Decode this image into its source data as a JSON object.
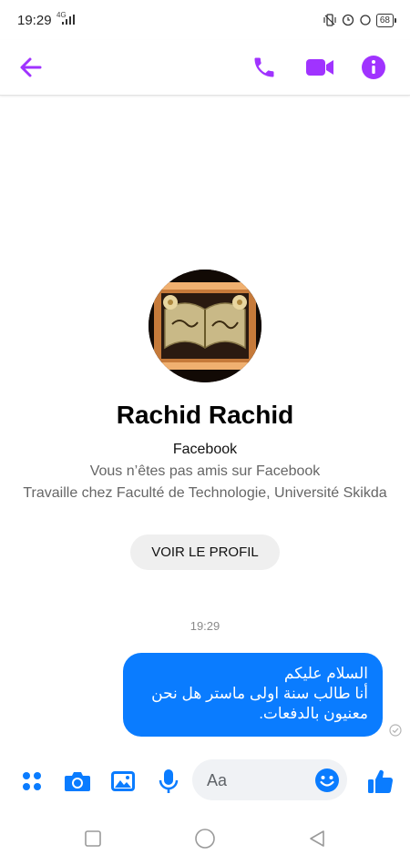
{
  "status_bar": {
    "time": "19:29",
    "network": "4G",
    "battery": "68"
  },
  "header": {
    "back_icon": "arrow-left-icon",
    "call_icon": "phone-icon",
    "video_icon": "video-camera-icon",
    "info_icon": "info-icon",
    "accent_color": "#a033ff"
  },
  "profile": {
    "name": "Rachid Rachid",
    "platform": "Facebook",
    "friend_status": "Vous n’êtes pas amis sur Facebook",
    "work": "Travaille chez Faculté de Technologie, Université Skikda",
    "view_profile_label": "VOIR LE PROFIL"
  },
  "conversation": {
    "timestamp": "19:29",
    "messages": [
      {
        "direction": "outgoing",
        "lines": [
          "السلام عليكم",
          "أنا طالب سنة اولى ماستر هل نحن معنيون بالدفعات."
        ],
        "status": "sent"
      }
    ],
    "bubble_color": "#0a7cff"
  },
  "composer": {
    "placeholder": "Aa",
    "icons": [
      "menu-dots-icon",
      "camera-icon",
      "gallery-icon",
      "microphone-icon",
      "emoji-icon",
      "like-icon"
    ]
  },
  "navbar": {
    "icons": [
      "recent-apps-icon",
      "home-icon",
      "back-icon"
    ]
  }
}
